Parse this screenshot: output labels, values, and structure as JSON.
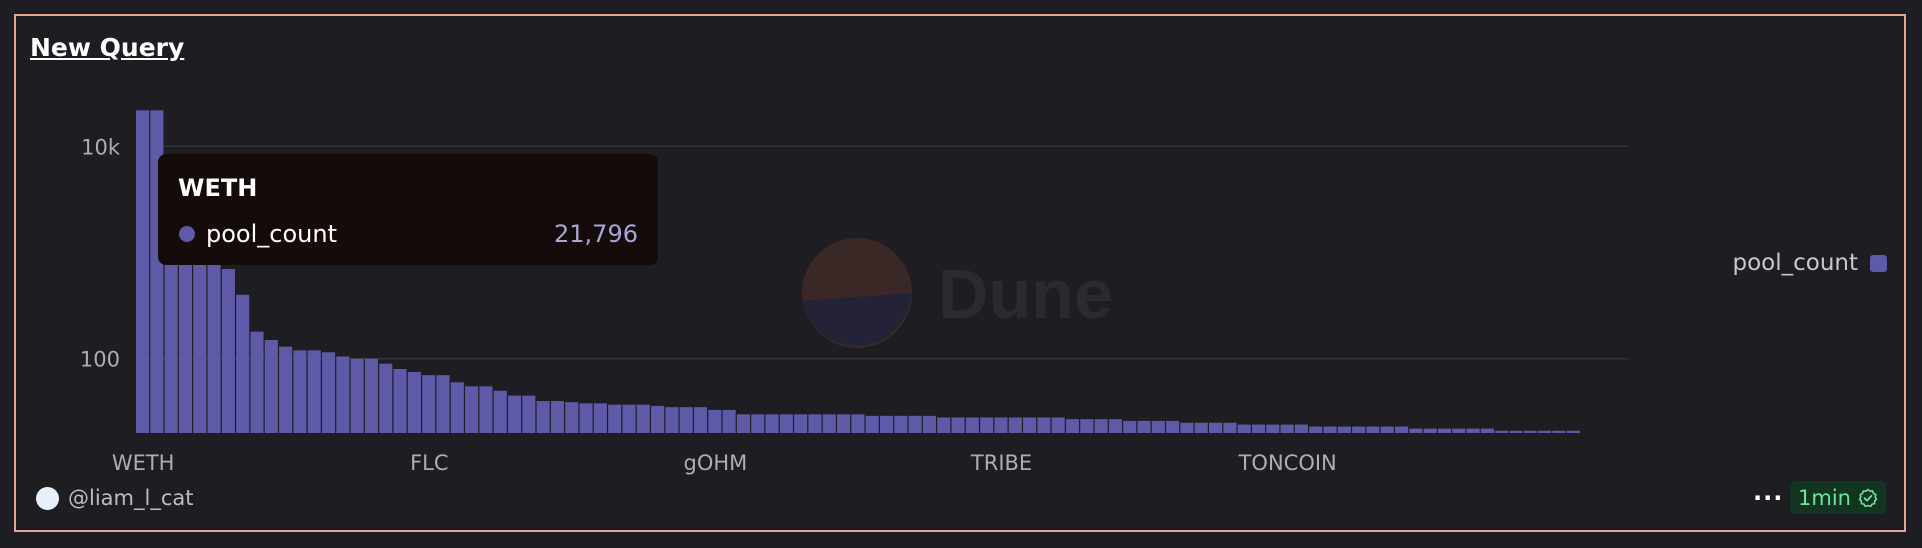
{
  "header": {
    "title": "New Query"
  },
  "tooltip": {
    "title": "WETH",
    "series": "pool_count",
    "value": "21,796"
  },
  "legend": {
    "label": "pool_count"
  },
  "watermark": {
    "text": "Dune"
  },
  "footer": {
    "author": "@liam_l_cat",
    "more": "···",
    "refresh": "1min"
  },
  "colors": {
    "bar": "#5e5aa8",
    "background": "#1e1d22",
    "panel_border": "#e4a690",
    "grid": "#35343b",
    "axis_text": "#aeadb4",
    "refresh_text": "#6fe39a"
  },
  "chart_data": {
    "type": "bar",
    "scale": "log",
    "series": [
      {
        "name": "pool_count",
        "values": [
          21796,
          21796,
          2500,
          1700,
          1400,
          1000,
          700,
          400,
          180,
          150,
          130,
          120,
          120,
          115,
          105,
          100,
          100,
          90,
          80,
          75,
          70,
          70,
          60,
          55,
          55,
          50,
          45,
          45,
          40,
          40,
          39,
          38,
          38,
          37,
          37,
          37,
          36,
          35,
          35,
          35,
          33,
          33,
          30,
          30,
          30,
          30,
          30,
          30,
          30,
          30,
          30,
          29,
          29,
          29,
          29,
          29,
          28,
          28,
          28,
          28,
          28,
          28,
          28,
          28,
          28,
          27,
          27,
          27,
          27,
          26,
          26,
          26,
          26,
          25,
          25,
          25,
          25,
          24,
          24,
          24,
          24,
          24,
          23,
          23,
          23,
          23,
          23,
          23,
          23,
          22,
          22,
          22,
          22,
          22,
          22,
          21,
          21,
          21,
          21,
          21,
          21
        ]
      }
    ],
    "category_labels": [
      {
        "index": 0,
        "label": "WETH"
      },
      {
        "index": 20,
        "label": "FLC"
      },
      {
        "index": 40,
        "label": "gOHM"
      },
      {
        "index": 60,
        "label": "TRIBE"
      },
      {
        "index": 80,
        "label": "TONCOIN"
      }
    ],
    "y_ticks": [
      {
        "value": 100,
        "label": "100"
      },
      {
        "value": 10000,
        "label": "10k"
      }
    ],
    "ylim": [
      20,
      25000
    ],
    "grid": true,
    "legend_position": "right"
  }
}
